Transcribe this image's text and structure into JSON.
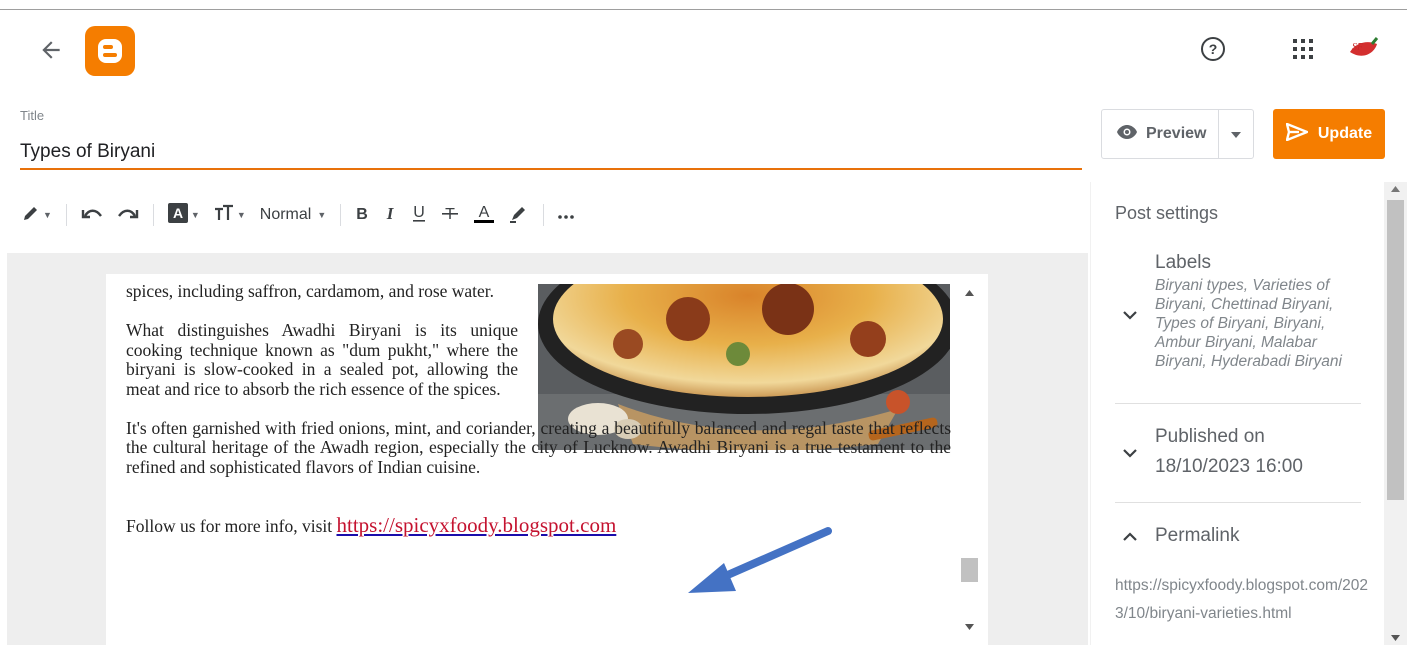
{
  "header": {
    "back_icon": "arrow-left-icon",
    "logo": "blogger-logo",
    "help_icon": "help-circle-icon",
    "apps_icon": "apps-grid-icon",
    "avatar": "user-avatar"
  },
  "post": {
    "title_label": "Title",
    "title_value": "Types of Biryani"
  },
  "actions": {
    "preview_label": "Preview",
    "update_label": "Update"
  },
  "toolbar": {
    "style_value": "Normal"
  },
  "content": {
    "para1": "spices, including saffron, cardamom, and rose water.",
    "para2": "What distinguishes Awadhi Biryani is its unique cooking technique known as \"dum pukht,\" where the biryani is slow-cooked in a sealed pot, allowing the meat and rice to absorb the rich essence of the spices.",
    "para3": "It's often garnished with fried onions, mint, and coriander, creating a beautifully balanced and regal taste that reflects the cultural heritage of the Awadh region, especially the city of Lucknow. Awadhi Biryani is a true testament to the refined and sophisticated flavors of Indian cuisine.",
    "follow_text": "Follow us for more info, visit ",
    "follow_link": "https://spicyxfoody.blogspot.com"
  },
  "settings": {
    "heading": "Post settings",
    "labels_title": "Labels",
    "labels_value": "Biryani types, Varieties of Biryani, Chettinad Biryani, Types of Biryani, Biryani, Ambur Biryani, Malabar Biryani, Hyderabadi Biryani",
    "published_title": "Published on",
    "published_value": "18/10/2023 16:00",
    "permalink_title": "Permalink",
    "permalink_value": "https://spicyxfoody.blogspot.com/2023/10/biryani-varieties.html"
  },
  "colors": {
    "accent": "#f57d00",
    "link": "#c4122f",
    "annotation_arrow": "#4472c4"
  }
}
